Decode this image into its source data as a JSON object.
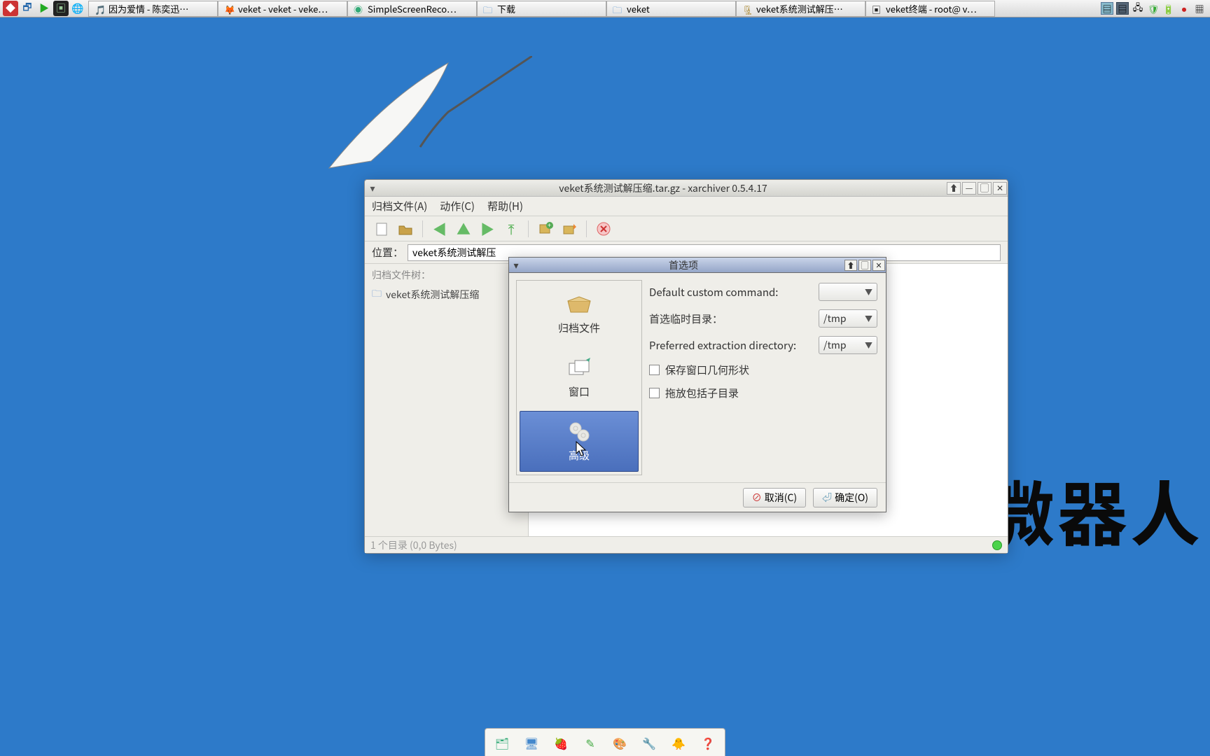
{
  "taskbar": {
    "tasks": [
      {
        "label": "因为爱情 - 陈奕迅…",
        "icon": "audio"
      },
      {
        "label": "veket - veket - veke…",
        "icon": "firefox"
      },
      {
        "label": "SimpleScreenReco…",
        "icon": "record"
      },
      {
        "label": "下载",
        "icon": "folder"
      },
      {
        "label": "veket",
        "icon": "folder"
      },
      {
        "label": "veket系统测试解压…",
        "icon": "archive"
      },
      {
        "label": "veket终端 - root@ v…",
        "icon": "terminal"
      }
    ]
  },
  "watermark": "微器人",
  "archiver": {
    "title": "veket系统测试解压缩.tar.gz - xarchiver 0.5.4.17",
    "menus": {
      "archive": "归档文件(A)",
      "action": "动作(C)",
      "help": "帮助(H)"
    },
    "location_label": "位置：",
    "location_value": "veket系统测试解压",
    "tree_header": "归档文件树：",
    "tree_node": "veket系统测试解压缩",
    "status": "1 个目录 (0,0 Bytes)"
  },
  "prefs": {
    "title": "首选项",
    "tabs": {
      "archive": "归档文件",
      "window": "窗口",
      "advanced": "高级"
    },
    "labels": {
      "default_cmd": "Default custom command:",
      "temp_dir": "首选临时目录：",
      "extract_dir": "Preferred extraction directory:",
      "save_geom": "保存窗口几何形状",
      "drag_subdir": "拖放包括子目录"
    },
    "values": {
      "default_cmd": "",
      "temp_dir": "/tmp",
      "extract_dir": "/tmp"
    },
    "buttons": {
      "cancel": "取消(C)",
      "ok": "确定(O)"
    }
  }
}
